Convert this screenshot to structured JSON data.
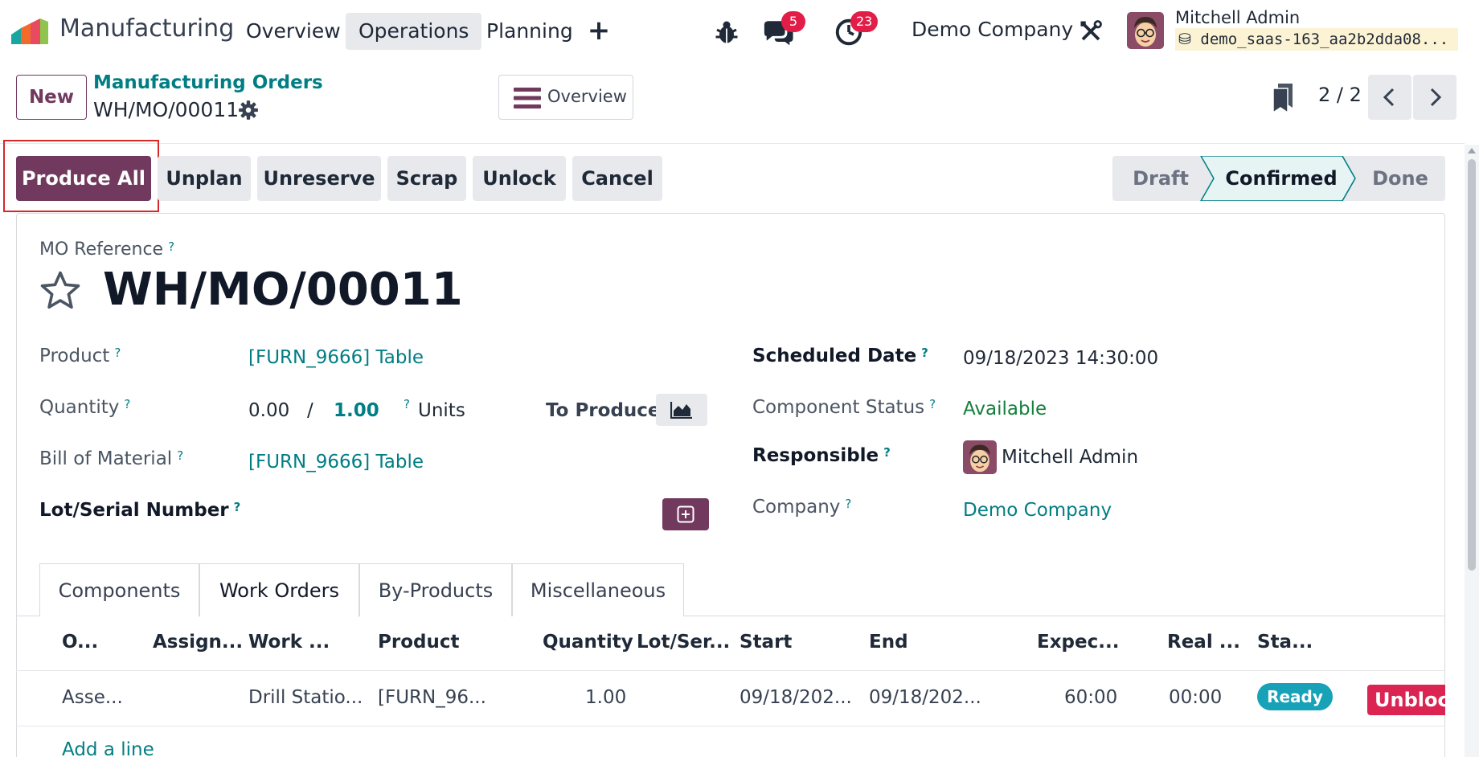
{
  "navbar": {
    "app_name": "Manufacturing",
    "menu": [
      "Overview",
      "Operations",
      "Planning"
    ],
    "active_menu": "Operations",
    "messages_count": "5",
    "activities_count": "23",
    "company": "Demo Company",
    "user_name": "Mitchell Admin",
    "database": "demo_saas-163_aa2b2dda08..."
  },
  "control_panel": {
    "new_label": "New",
    "breadcrumb_parent": "Manufacturing Orders",
    "record_name": "WH/MO/00011",
    "overview_label": "Overview",
    "pager": "2 / 2"
  },
  "actions": {
    "produce_all": "Produce All",
    "unplan": "Unplan",
    "unreserve": "Unreserve",
    "scrap": "Scrap",
    "unlock": "Unlock",
    "cancel": "Cancel"
  },
  "statusbar": {
    "stages": [
      "Draft",
      "Confirmed",
      "Done"
    ],
    "current": "Confirmed"
  },
  "form": {
    "mo_reference_label": "MO Reference",
    "mo_reference": "WH/MO/00011",
    "product_label": "Product",
    "product": "[FURN_9666] Table",
    "quantity_label": "Quantity",
    "qty_produced": "0.00",
    "qty_separator": "/",
    "qty_to_produce": "1.00",
    "qty_uom": "Units",
    "to_produce_label": "To Produce",
    "bom_label": "Bill of Material",
    "bom": "[FURN_9666] Table",
    "lot_label": "Lot/Serial Number",
    "scheduled_date_label": "Scheduled Date",
    "scheduled_date": "09/18/2023 14:30:00",
    "component_status_label": "Component Status",
    "component_status": "Available",
    "responsible_label": "Responsible",
    "responsible": "Mitchell Admin",
    "company_label": "Company",
    "company": "Demo Company",
    "help_mark": "?"
  },
  "tabs": [
    {
      "label": "Components"
    },
    {
      "label": "Work Orders",
      "active": true
    },
    {
      "label": "By-Products"
    },
    {
      "label": "Miscellaneous"
    }
  ],
  "work_orders": {
    "columns": [
      "O...",
      "Assign...",
      "Work ...",
      "Product",
      "Quantity",
      "Lot/Ser...",
      "Start",
      "End",
      "Expec...",
      "Real ...",
      "Sta..."
    ],
    "rows": [
      {
        "operation": "Asse...",
        "assigned": "",
        "work_center": "Drill Statio...",
        "product": "[FURN_96...",
        "quantity": "1.00",
        "lot": "",
        "start": "09/18/202...",
        "end": "09/18/202...",
        "expected": "60:00",
        "real": "00:00",
        "status": "Ready",
        "action": "Unblock"
      }
    ],
    "add_line": "Add a line"
  },
  "colors": {
    "primary": "#71395e",
    "link": "#017e84",
    "ready": "#17a2b8",
    "unblock": "#dc2453",
    "available": "#15803d",
    "badge": "#e11d48"
  }
}
